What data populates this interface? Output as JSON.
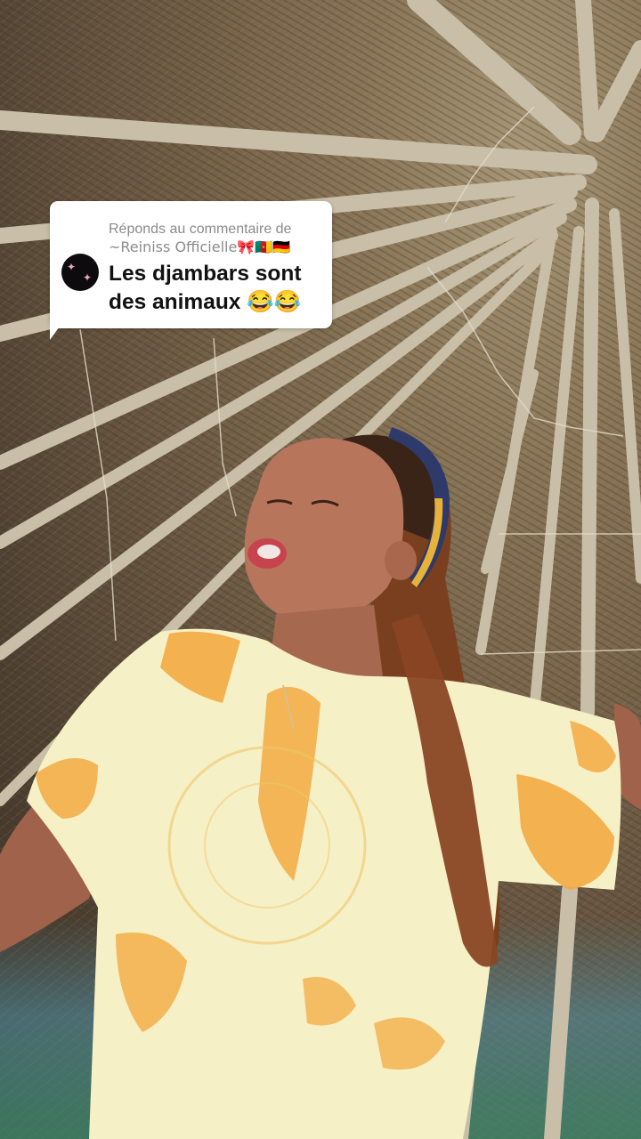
{
  "reply_sticker": {
    "header_line1": "Réponds au commentaire de",
    "header_line2": "~Reiniss Officielle🎀🇨🇲🇩🇪",
    "comment_line1": "Les djambars sont",
    "comment_line2": "des animaux 😂😂",
    "avatar_icon": "butterfly-avatar-icon"
  },
  "colors": {
    "card_bg": "#ffffff",
    "header_text": "#8b8b8b",
    "comment_text": "#111111",
    "dress_orange": "#f3a63a",
    "dress_light": "#f6f0c6"
  }
}
